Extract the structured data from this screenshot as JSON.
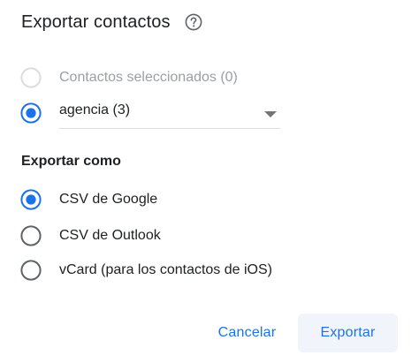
{
  "dialog": {
    "title": "Exportar contactos",
    "help_icon": "help-circle-icon"
  },
  "source": {
    "options": [
      {
        "label": "Contactos seleccionados (0)",
        "selected": false,
        "disabled": true
      },
      {
        "label": "agencia (3)",
        "selected": true,
        "disabled": false
      }
    ],
    "dropdown_value": "agencia (3)"
  },
  "export_as": {
    "heading": "Exportar como",
    "options": [
      {
        "label": "CSV de Google",
        "selected": true
      },
      {
        "label": "CSV de Outlook",
        "selected": false
      },
      {
        "label": "vCard (para los contactos de iOS)",
        "selected": false
      }
    ]
  },
  "actions": {
    "cancel_label": "Cancelar",
    "export_label": "Exportar"
  },
  "colors": {
    "accent": "#1a73e8",
    "text": "#202124",
    "disabled_text": "#9aa0a6",
    "radio_unselected": "#5f6368",
    "radio_disabled": "#dadce0",
    "export_button_bg": "#f1f5fb"
  }
}
